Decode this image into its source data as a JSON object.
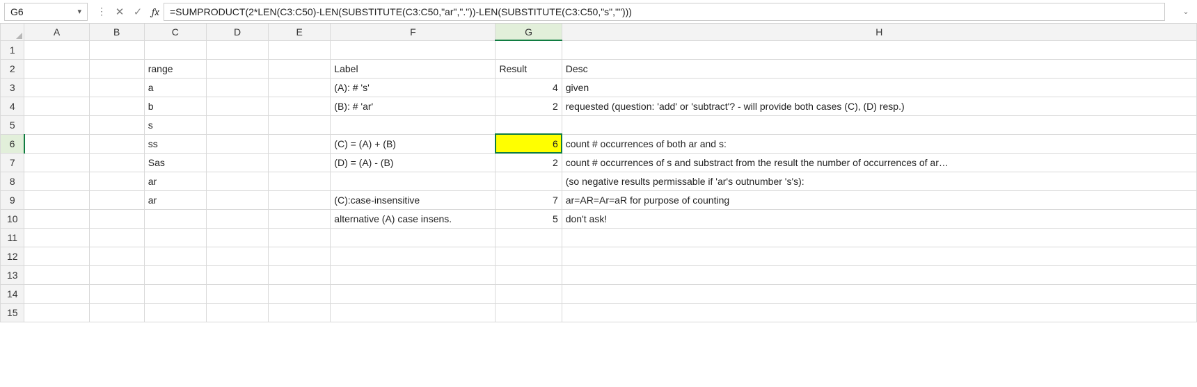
{
  "name_box": "G6",
  "fx_label": "fx",
  "formula": "=SUMPRODUCT(2*LEN(C3:C50)-LEN(SUBSTITUTE(C3:C50,\"ar\",\".\"))-LEN(SUBSTITUTE(C3:C50,\"s\",\"\")))",
  "columns": [
    "A",
    "B",
    "C",
    "D",
    "E",
    "F",
    "G",
    "H"
  ],
  "active_col": "G",
  "active_row": 6,
  "rows": 15,
  "cells": {
    "C2": "range",
    "F2": "Label",
    "G2": "Result",
    "H2": "Desc",
    "C3": "a",
    "F3": "(A): # 's'",
    "G3": "4",
    "H3": "given",
    "C4": "b",
    "F4": "(B): # 'ar'",
    "G4": "2",
    "H4": "requested (question: 'add' or 'subtract'? - will provide both cases (C), (D) resp.)",
    "C5": "s",
    "C6": "ss",
    "F6": "(C) = (A) + (B)",
    "G6": "6",
    "H6": "count # occurrences of both ar and s:",
    "C7": "Sas",
    "F7": "(D) = (A) - (B)",
    "G7": "2",
    "H7": "count # occurrences of s and substract from the result the number of occurrences of ar…",
    "C8": "ar",
    "H8": "  (so negative results permissable if 'ar's outnumber 's's):",
    "C9": "ar",
    "F9": "(C):case-insensitive",
    "G9": "7",
    "H9": "ar=AR=Ar=aR for purpose of counting",
    "F10": "alternative (A) case insens.",
    "G10": "5",
    "H10": "don't ask!"
  },
  "numeric_cells": [
    "G3",
    "G4",
    "G6",
    "G7",
    "G9",
    "G10"
  ]
}
